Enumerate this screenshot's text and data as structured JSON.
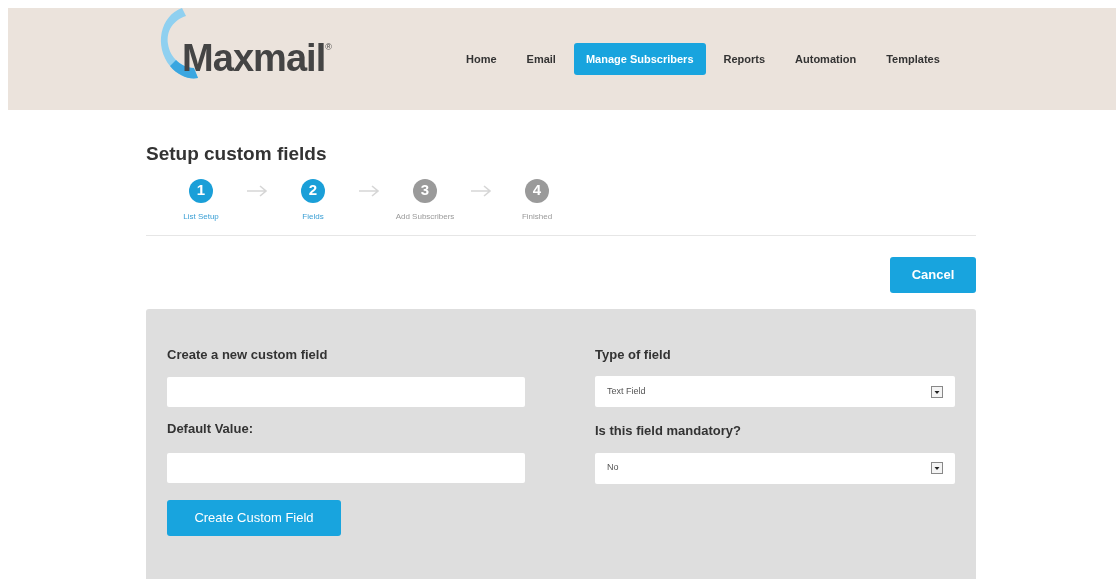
{
  "logo": {
    "text": "Maxmail",
    "mark": "®"
  },
  "nav": [
    {
      "label": "Home",
      "selected": false
    },
    {
      "label": "Email",
      "selected": false
    },
    {
      "label": "Manage Subscribers",
      "selected": true
    },
    {
      "label": "Reports",
      "selected": false
    },
    {
      "label": "Automation",
      "selected": false
    },
    {
      "label": "Templates",
      "selected": false
    }
  ],
  "title": "Setup custom fields",
  "steps": [
    {
      "number": "1",
      "label": "List Setup",
      "active": true
    },
    {
      "number": "2",
      "label": "Fields",
      "active": true
    },
    {
      "number": "3",
      "label": "Add Subscribers",
      "active": false
    },
    {
      "number": "4",
      "label": "Finished",
      "active": false
    }
  ],
  "cancel_button": "Cancel",
  "form": {
    "name_label": "Create a new custom field",
    "default_label": "Default Value:",
    "type_label": "Type of field",
    "type_value": "Text Field",
    "mandatory_label": "Is this field mandatory?",
    "mandatory_value": "No",
    "submit": "Create Custom Field"
  }
}
